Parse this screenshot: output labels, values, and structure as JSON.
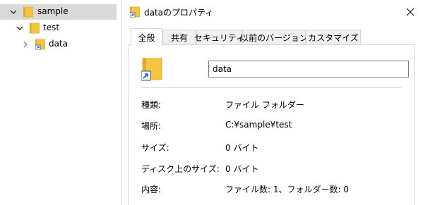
{
  "tree": {
    "items": [
      {
        "label": "sample",
        "expanded": true,
        "selected": true
      },
      {
        "label": "test",
        "expanded": true,
        "selected": false
      },
      {
        "label": "data",
        "expanded": false,
        "selected": false,
        "shortcut": true
      }
    ]
  },
  "dialog": {
    "title": "dataのプロパティ",
    "close_icon": "close-icon",
    "tabs": [
      {
        "label": "全般",
        "active": true
      },
      {
        "label": "共有",
        "active": false
      },
      {
        "label": "セキュリティ",
        "active": false
      },
      {
        "label": "以前のバージョン",
        "active": false
      },
      {
        "label": "カスタマイズ",
        "active": false
      }
    ],
    "name_value": "data",
    "properties": [
      {
        "label": "種類:",
        "value": "ファイル フォルダー"
      },
      {
        "label": "場所:",
        "value": "C:¥sample¥test"
      },
      {
        "label": "サイズ:",
        "value": "0 バイト"
      },
      {
        "label": "ディスク上のサイズ:",
        "value": "0 バイト"
      },
      {
        "label": "内容:",
        "value": "ファイル数: 1、フォルダー数: 0"
      }
    ]
  },
  "colors": {
    "folder": "#f4c542",
    "folder_dark": "#e0a92b",
    "selection": "#d9d9d9",
    "border": "#d9d9d9",
    "shortcut_arrow": "#1a5fb4"
  }
}
